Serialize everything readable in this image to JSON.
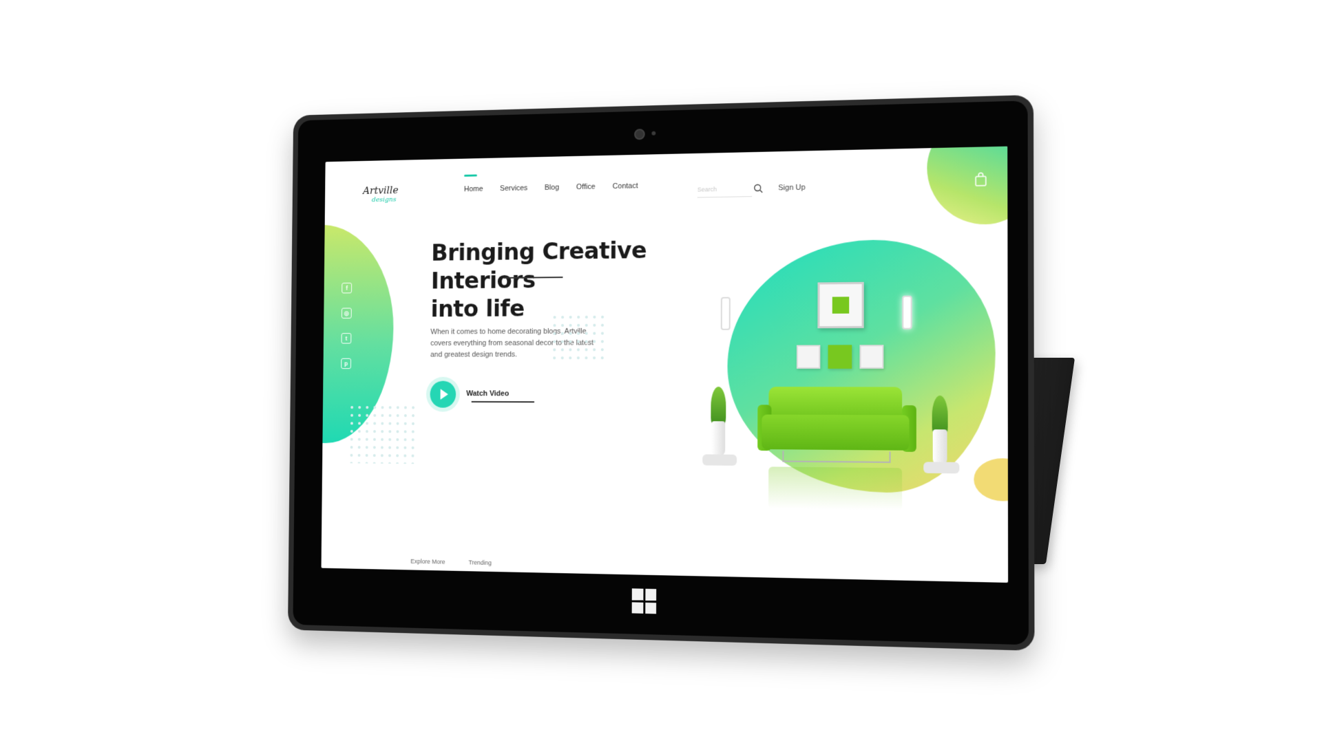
{
  "brand": {
    "name": "Artville",
    "tagline": "designs",
    "accent_color": "#19c9a8"
  },
  "nav": {
    "items": [
      {
        "label": "Home",
        "active": true
      },
      {
        "label": "Services",
        "active": false
      },
      {
        "label": "Blog",
        "active": false
      },
      {
        "label": "Office",
        "active": false
      },
      {
        "label": "Contact",
        "active": false
      }
    ],
    "search_placeholder": "Search",
    "signup_label": "Sign Up",
    "cart_icon": "shopping-bag-icon"
  },
  "social": {
    "icons": [
      "facebook-icon",
      "instagram-icon",
      "twitter-icon",
      "pinterest-icon"
    ]
  },
  "hero": {
    "title_line1": "Bringing Creative Interiors",
    "title_line2": "into life",
    "description": "When it comes to home decorating blogs, Artville covers everything from seasonal decor to the latest and greatest design trends.",
    "watch_label": "Watch Video"
  },
  "bottom_links": [
    "Explore More",
    "Trending"
  ],
  "colors": {
    "blob_green": "#63dfa0",
    "blob_teal": "#1fd9b3",
    "blob_yellow": "#f3d56d",
    "sofa_green": "#78c81f"
  }
}
